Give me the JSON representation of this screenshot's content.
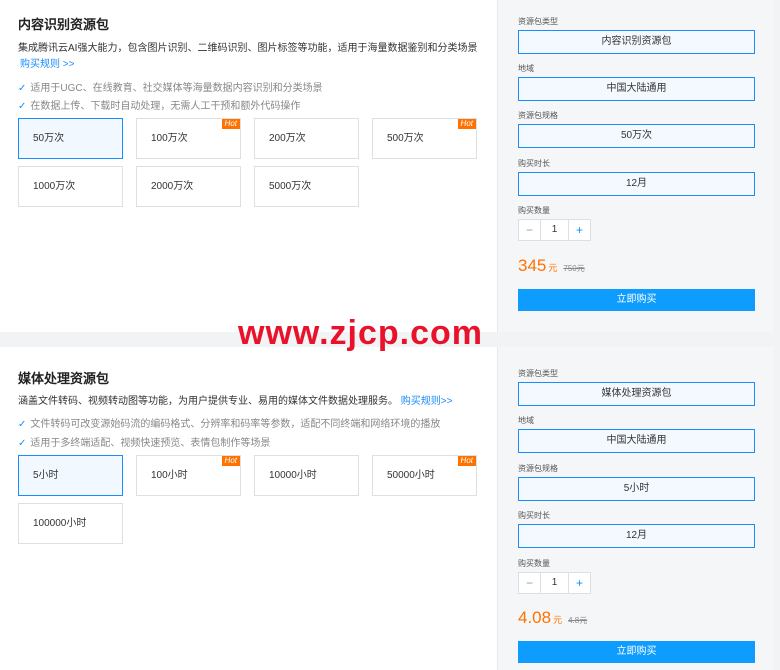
{
  "packages": [
    {
      "title": "内容识别资源包",
      "desc": "集成腾讯云AI强大能力，包含图片识别、二维码识别、图片标签等功能，适用于海量数据鉴别和分类场景",
      "rules_link": "购买规则 >>",
      "features": [
        "适用于UGC、在线教育、社交媒体等海量数据内容识别和分类场景",
        "在数据上传、下载时自动处理，无需人工干预和额外代码操作"
      ],
      "options": [
        {
          "label": "50万次",
          "hot": ""
        },
        {
          "label": "100万次",
          "hot": "Hot"
        },
        {
          "label": "200万次",
          "hot": ""
        },
        {
          "label": "500万次",
          "hot": "Hot"
        },
        {
          "label": "1000万次",
          "hot": ""
        },
        {
          "label": "2000万次",
          "hot": ""
        },
        {
          "label": "5000万次",
          "hot": ""
        }
      ],
      "form": {
        "type_label": "资源包类型",
        "type_value": "内容识别资源包",
        "region_label": "地域",
        "region_value": "中国大陆通用",
        "spec_label": "资源包规格",
        "spec_value": "50万次",
        "duration_label": "购买时长",
        "duration_value": "12月",
        "qty_label": "购买数量",
        "qty_value": "1",
        "minus": "−",
        "plus": "+",
        "price": "345",
        "unit": "元",
        "orig_price": "750元",
        "buy_label": "立即购买"
      }
    },
    {
      "title": "媒体处理资源包",
      "desc": "涵盖文件转码、视频转动图等功能，为用户提供专业、易用的媒体文件数据处理服务。",
      "rules_link": "购买规则>>",
      "features": [
        "文件转码可改变源始码流的编码格式、分辨率和码率等参数，适配不同终端和网络环境的播放",
        "适用于多终端适配、视频快速预览、表情包制作等场景"
      ],
      "options": [
        {
          "label": "5小时",
          "hot": ""
        },
        {
          "label": "100小时",
          "hot": "Hot"
        },
        {
          "label": "10000小时",
          "hot": ""
        },
        {
          "label": "50000小时",
          "hot": "Hot"
        },
        {
          "label": "100000小时",
          "hot": ""
        }
      ],
      "form": {
        "type_label": "资源包类型",
        "type_value": "媒体处理资源包",
        "region_label": "地域",
        "region_value": "中国大陆通用",
        "spec_label": "资源包规格",
        "spec_value": "5小时",
        "duration_label": "购买时长",
        "duration_value": "12月",
        "qty_label": "购买数量",
        "qty_value": "1",
        "minus": "−",
        "plus": "+",
        "price": "4.08",
        "unit": "元",
        "orig_price": "4.8元",
        "buy_label": "立即购买"
      }
    }
  ],
  "watermark": "www.zjcp.com",
  "colors": {
    "accent": "#1a8cff",
    "price": "#ff7200",
    "hot": "#ff7200",
    "buy": "#0f9cff",
    "watermark": "#e8132b"
  }
}
